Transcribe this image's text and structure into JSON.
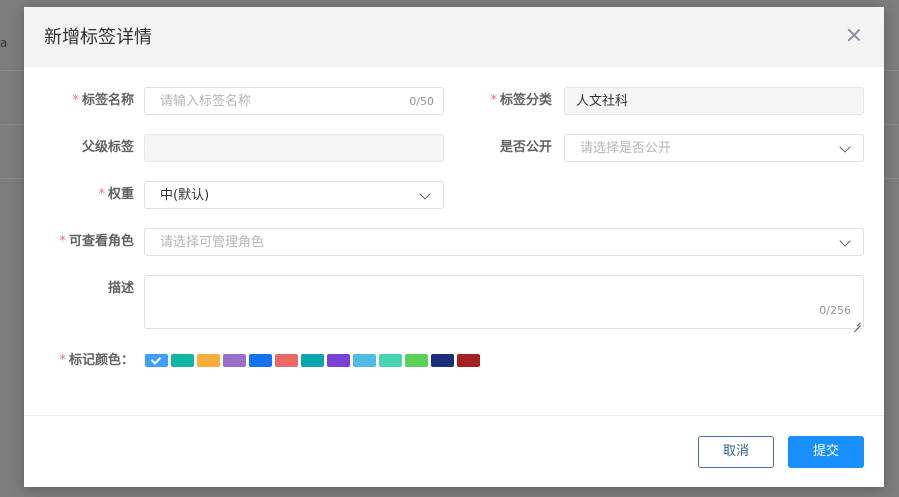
{
  "background": {
    "mark": "a"
  },
  "dialog": {
    "title": "新增标签详情",
    "close_icon": "close-icon"
  },
  "form": {
    "tag_name": {
      "label": "标签名称",
      "required": "*",
      "placeholder": "请输入标签名称",
      "count": "0/50"
    },
    "tag_category": {
      "label": "标签分类",
      "required": "*",
      "value": "人文社科"
    },
    "parent_tag": {
      "label": "父级标签",
      "value": ""
    },
    "is_public": {
      "label": "是否公开",
      "placeholder": "请选择是否公开"
    },
    "weight": {
      "label": "权重",
      "required": "*",
      "value": "中(默认)"
    },
    "viewer_roles": {
      "label": "可查看角色",
      "required": "*",
      "placeholder": "请选择可管理角色"
    },
    "description": {
      "label": "描述",
      "count": "0/256"
    },
    "tag_color": {
      "label": "标记颜色：",
      "required": "*",
      "selected_index": 0,
      "colors": [
        "#409eff",
        "#13b5a5",
        "#f8ae3a",
        "#9b6fc9",
        "#1472ee",
        "#ec6868",
        "#0aa5ae",
        "#7b40d8",
        "#4dbde6",
        "#48d6b1",
        "#5bd15a",
        "#1a2e7a",
        "#a52020"
      ]
    }
  },
  "footer": {
    "cancel_label": "取消",
    "submit_label": "提交"
  }
}
